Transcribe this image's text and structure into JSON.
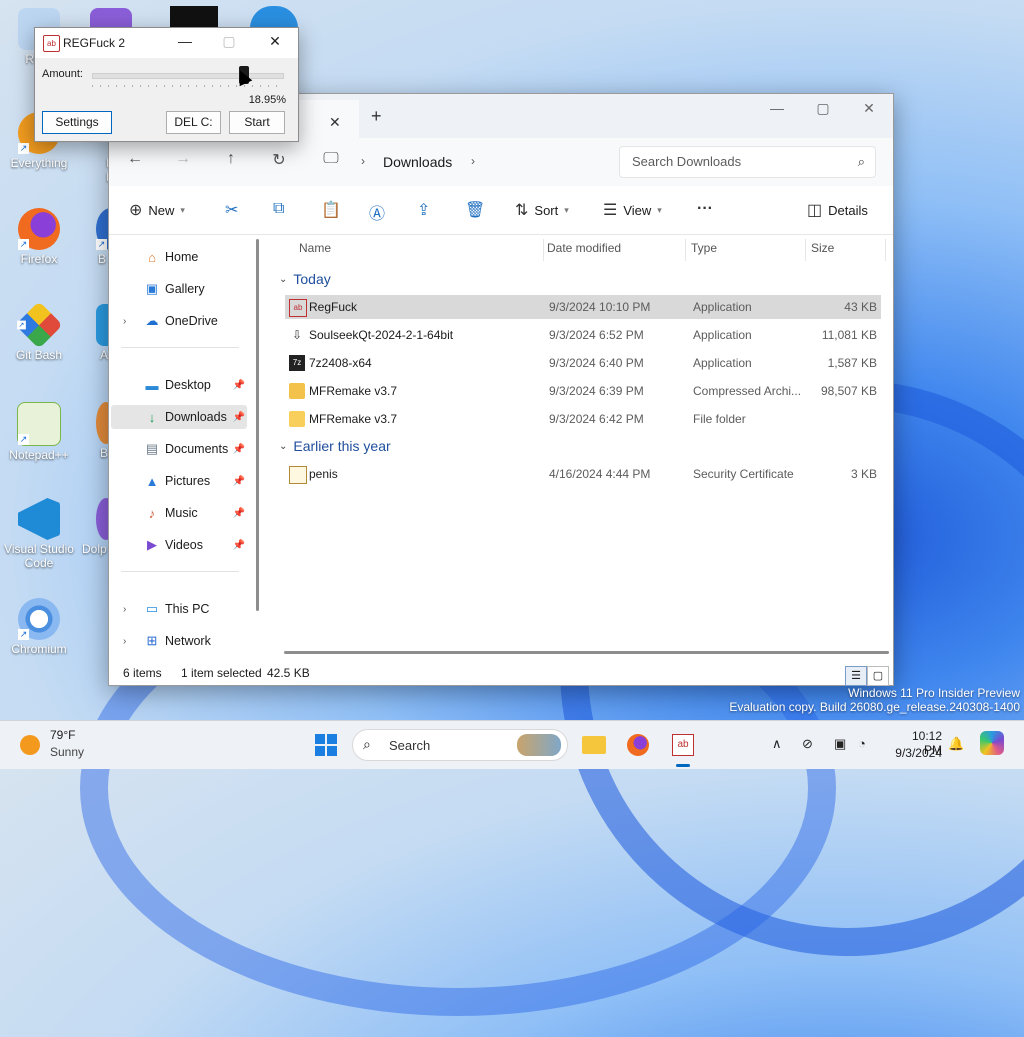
{
  "desktop": {
    "icons": [
      {
        "label": "Recy",
        "color": "#6aa8e8"
      },
      {
        "label": "Everything",
        "color": "#f29c1f"
      },
      {
        "label": "Firefox",
        "color": "#e66a1f"
      },
      {
        "label": "Git Bash",
        "color": "#e04a3a"
      },
      {
        "label": "Notepad++",
        "color": "#7ab648"
      },
      {
        "label": "Visual Studio Code",
        "color": "#1f8ad6"
      },
      {
        "label": "Chromium",
        "color": "#4a8fe0"
      }
    ],
    "icons_col2": [
      {
        "label": "Resu Expl",
        "color": "#3b7dd8"
      },
      {
        "label": "B Br",
        "color": "#2f6fd0"
      },
      {
        "label": "A",
        "color": "#2a9ae0"
      },
      {
        "label": "B",
        "color": "#e08a3a"
      },
      {
        "label": "Dolp",
        "color": "#8a5ed8"
      }
    ]
  },
  "regfuck": {
    "title": "REGFuck 2",
    "icon_text": "ab",
    "amount_label": "Amount:",
    "percent": "18.95%",
    "slider_level": 0.8,
    "buttons": {
      "settings": "Settings",
      "del": "DEL C:",
      "start": "Start"
    }
  },
  "explorer": {
    "nav": {
      "location": "Downloads",
      "search_placeholder": "Search Downloads"
    },
    "toolbar": {
      "new": "New",
      "sort": "Sort",
      "view": "View",
      "details": "Details"
    },
    "sidebar": [
      {
        "label": "Home",
        "icon": "home-icon"
      },
      {
        "label": "Gallery",
        "icon": "gallery-icon"
      },
      {
        "label": "OneDrive",
        "icon": "cloud-icon"
      },
      {
        "label": "Desktop",
        "icon": "desktop-icon"
      },
      {
        "label": "Downloads",
        "icon": "download-icon"
      },
      {
        "label": "Documents",
        "icon": "document-icon"
      },
      {
        "label": "Pictures",
        "icon": "picture-icon"
      },
      {
        "label": "Music",
        "icon": "music-icon"
      },
      {
        "label": "Videos",
        "icon": "video-icon"
      },
      {
        "label": "This PC",
        "icon": "pc-icon"
      },
      {
        "label": "Network",
        "icon": "network-icon"
      }
    ],
    "columns": {
      "name": "Name",
      "date": "Date modified",
      "type": "Type",
      "size": "Size"
    },
    "groups": {
      "today": "Today",
      "earlier": "Earlier this year"
    },
    "files": [
      {
        "name": "RegFuck",
        "date": "9/3/2024 10:10 PM",
        "type": "Application",
        "size": "43 KB"
      },
      {
        "name": "SoulseekQt-2024-2-1-64bit",
        "date": "9/3/2024 6:52 PM",
        "type": "Application",
        "size": "11,081 KB"
      },
      {
        "name": "7z2408-x64",
        "date": "9/3/2024 6:40 PM",
        "type": "Application",
        "size": "1,587 KB"
      },
      {
        "name": "MFRemake v3.7",
        "date": "9/3/2024 6:39 PM",
        "type": "Compressed Archi...",
        "size": "98,507 KB"
      },
      {
        "name": "MFRemake v3.7",
        "date": "9/3/2024 6:42 PM",
        "type": "File folder",
        "size": ""
      },
      {
        "name": "penis",
        "date": "4/16/2024 4:44 PM",
        "type": "Security Certificate",
        "size": "3 KB"
      }
    ],
    "status": {
      "count": "6 items",
      "selection": "1 item selected",
      "selsize": "42.5 KB"
    }
  },
  "watermark": {
    "line1": "Windows 11 Pro Insider Preview",
    "line2": "Evaluation copy. Build 26080.ge_release.240308-1400"
  },
  "taskbar": {
    "weather_temp": "79°F",
    "weather_cond": "Sunny",
    "search": "Search",
    "time": "10:12 PM",
    "date": "9/3/2024",
    "accent": "#0067c0"
  }
}
